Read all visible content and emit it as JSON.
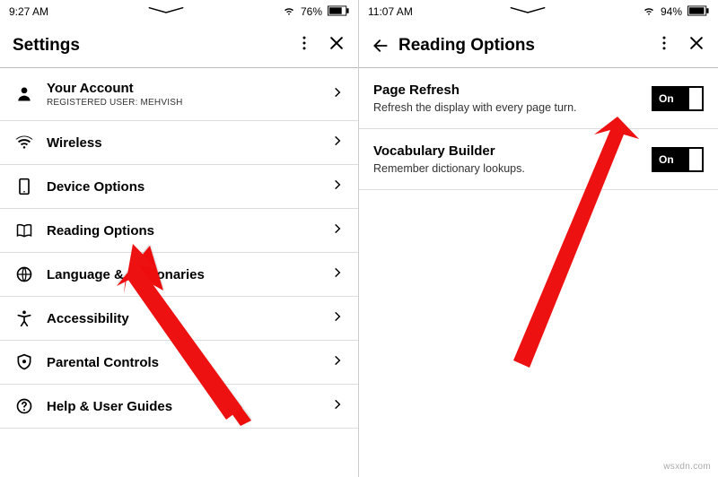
{
  "watermark": "wsxdn.com",
  "left": {
    "status": {
      "time": "9:27 AM",
      "battery": "76%"
    },
    "header": {
      "title": "Settings"
    },
    "items": [
      {
        "label": "Your Account",
        "sub": "REGISTERED USER: MEHVISH"
      },
      {
        "label": "Wireless"
      },
      {
        "label": "Device Options"
      },
      {
        "label": "Reading Options"
      },
      {
        "label": "Language & Dictionaries"
      },
      {
        "label": "Accessibility"
      },
      {
        "label": "Parental Controls"
      },
      {
        "label": "Help & User Guides"
      }
    ]
  },
  "right": {
    "status": {
      "time": "11:07 AM",
      "battery": "94%"
    },
    "header": {
      "title": "Reading Options"
    },
    "items": [
      {
        "title": "Page Refresh",
        "sub": "Refresh the display with every page turn.",
        "toggle": "On"
      },
      {
        "title": "Vocabulary Builder",
        "sub": "Remember dictionary lookups.",
        "toggle": "On"
      }
    ]
  }
}
